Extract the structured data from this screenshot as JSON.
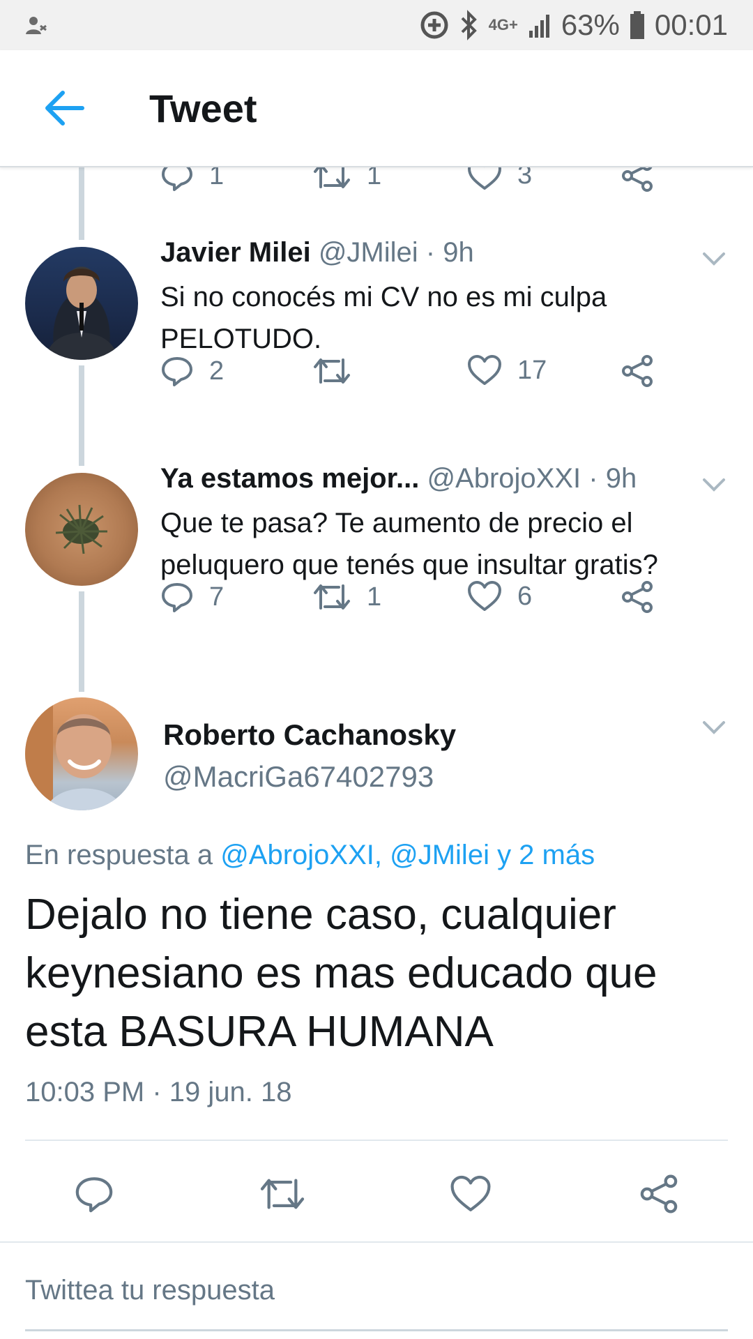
{
  "status_bar": {
    "network": "4G+",
    "battery": "63%",
    "time": "00:01"
  },
  "app_bar": {
    "title": "Tweet"
  },
  "partial_tweet": {
    "replies": "1",
    "retweets": "1",
    "likes": "3"
  },
  "thread": [
    {
      "name": "Javier Milei",
      "handle": "@JMilei",
      "time": "· 9h",
      "text": "Si no conocés mi CV no es mi culpa PELOTUDO.",
      "replies": "2",
      "retweets": "",
      "likes": "17"
    },
    {
      "name": "Ya estamos mejor...",
      "handle": "@AbrojoXXI",
      "time": "· 9h",
      "text": "Que te pasa? Te aumento de precio el peluquero que tenés que insultar gratis?",
      "replies": "7",
      "retweets": "1",
      "likes": "6"
    }
  ],
  "main_tweet": {
    "name": "Roberto Cachanosky",
    "handle": "@MacriGa67402793",
    "reply_prefix": "En respuesta a",
    "reply_mentions": "@AbrojoXXI, @JMilei y 2 más",
    "text": "Dejalo no tiene caso, cualquier keynesiano es mas educado que esta BASURA HUMANA",
    "timestamp": "10:03 PM · 19 jun. 18"
  },
  "reply_box": {
    "placeholder": "Twittea tu respuesta"
  },
  "colors": {
    "accent": "#1da1f2",
    "secondary_text": "#657786",
    "thread_line": "#ccd6dd"
  },
  "icons": [
    "person-icon",
    "data-saver-icon",
    "bluetooth-icon",
    "signal-icon",
    "battery-icon",
    "back-arrow-icon",
    "reply-icon",
    "retweet-icon",
    "like-icon",
    "share-icon",
    "chevron-down-icon"
  ]
}
